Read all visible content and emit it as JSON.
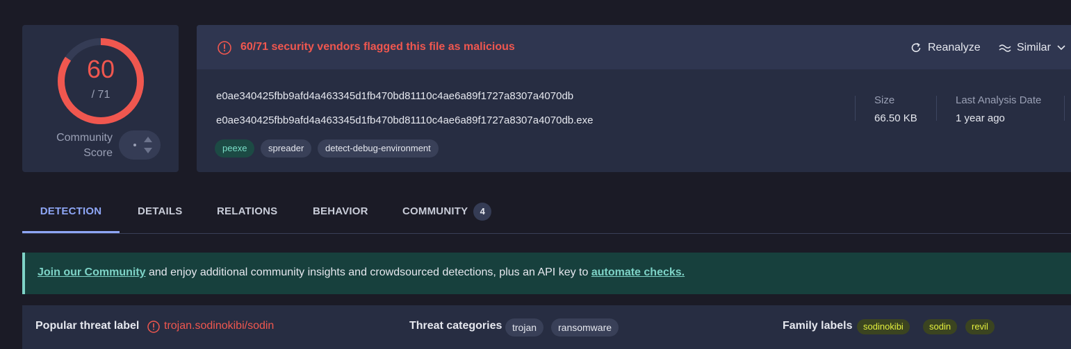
{
  "score": {
    "detections": "60",
    "total": "/ 71",
    "community_label_line1": "Community",
    "community_label_line2": "Score",
    "detection_fraction": 0.845
  },
  "alert": {
    "text": "60/71 security vendors flagged this file as malicious",
    "reanalyze_label": "Reanalyze",
    "similar_label": "Similar"
  },
  "file": {
    "hash": "e0ae340425fbb9afd4a463345d1fb470bd81110c4ae6a89f1727a8307a4070db",
    "name": "e0ae340425fbb9afd4a463345d1fb470bd81110c4ae6a89f1727a8307a4070db.exe",
    "tags": [
      "peexe",
      "spreader",
      "detect-debug-environment"
    ],
    "size_label": "Size",
    "size_value": "66.50 KB",
    "date_label": "Last Analysis Date",
    "date_value": "1 year ago"
  },
  "tabs": [
    {
      "label": "DETECTION"
    },
    {
      "label": "DETAILS"
    },
    {
      "label": "RELATIONS"
    },
    {
      "label": "BEHAVIOR"
    },
    {
      "label": "COMMUNITY",
      "count": "4"
    }
  ],
  "banner": {
    "link1": "Join our Community",
    "middle": " and enjoy additional community insights and crowdsourced detections, plus an API key to ",
    "link2": "automate checks."
  },
  "threat": {
    "popular_label": "Popular threat label",
    "popular_value": "trojan.sodinokibi/sodin",
    "categories_label": "Threat categories",
    "categories": [
      "trojan",
      "ransomware"
    ],
    "family_label": "Family labels",
    "families": [
      "sodinokibi",
      "sodin",
      "revil"
    ]
  },
  "colors": {
    "malicious": "#f0574f",
    "accent": "#8ea6f5",
    "family_tag": "#e3ef3d"
  }
}
